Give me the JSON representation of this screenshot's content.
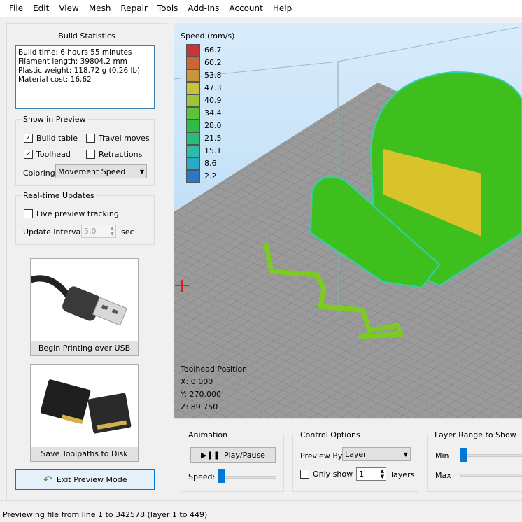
{
  "menu": [
    "File",
    "Edit",
    "View",
    "Mesh",
    "Repair",
    "Tools",
    "Add-Ins",
    "Account",
    "Help"
  ],
  "build_stats": {
    "title": "Build Statistics",
    "lines": [
      "Build time: 6 hours 55 minutes",
      "Filament length: 39804.2 mm",
      "Plastic weight: 118.72 g (0.26 lb)",
      "Material cost: 16.62"
    ]
  },
  "show_preview": {
    "title": "Show in Preview",
    "build_table": "Build table",
    "travel_moves": "Travel moves",
    "toolhead": "Toolhead",
    "retractions": "Retractions",
    "build_table_checked": true,
    "toolhead_checked": true,
    "travel_checked": false,
    "retractions_checked": false,
    "coloring_label": "Coloring",
    "coloring_value": "Movement Speed"
  },
  "realtime": {
    "title": "Real-time Updates",
    "live": "Live preview tracking",
    "interval_label": "Update interval",
    "interval_value": "5,0",
    "unit": "sec"
  },
  "usb_button": "Begin Printing over USB",
  "disk_button": "Save Toolpaths to Disk",
  "exit_button": "Exit Preview Mode",
  "legend": {
    "title": "Speed (mm/s)",
    "values": [
      "66.7",
      "60.2",
      "53.8",
      "47.3",
      "40.9",
      "34.4",
      "28.0",
      "21.5",
      "15.1",
      "8.6",
      "2.2"
    ],
    "colors": [
      "#c9343a",
      "#c8663a",
      "#c8963a",
      "#c6c43a",
      "#9ec53a",
      "#5cc23a",
      "#2bbd46",
      "#2bbd78",
      "#2bbda8",
      "#2ba8c8",
      "#2b78c8"
    ]
  },
  "toolhead": {
    "title": "Toolhead Position",
    "x": "X: 0.000",
    "y": "Y: 270.000",
    "z": "Z: 89.750"
  },
  "animation": {
    "title": "Animation",
    "play": "Play/Pause",
    "speed": "Speed:",
    "speed_value": 0
  },
  "control": {
    "title": "Control Options",
    "preview_by": "Preview By",
    "preview_value": "Layer",
    "only_show": "Only show",
    "layers_value": "1",
    "layers": "layers"
  },
  "layer_range": {
    "title": "Layer Range to Show",
    "min": "Min",
    "max": "Max",
    "min_value": 1,
    "max_value": 449
  },
  "status": "Previewing file from line 1 to 342578 (layer 1 to 449)"
}
